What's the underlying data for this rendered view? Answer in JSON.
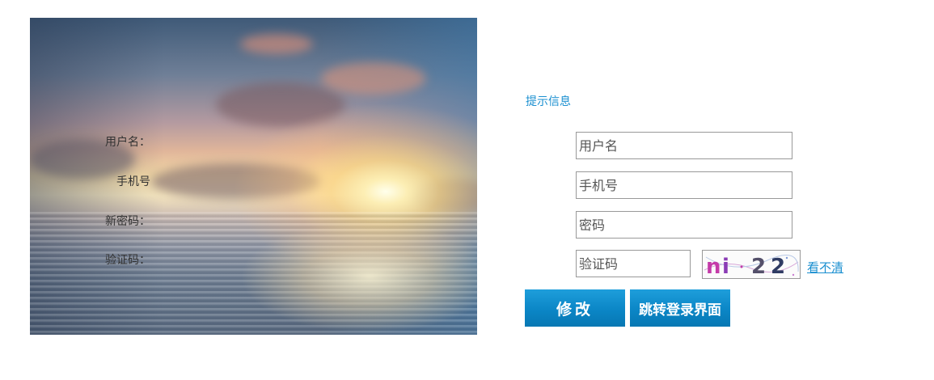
{
  "form": {
    "hint": "提示信息",
    "username": {
      "label": "用户名：",
      "placeholder": "用户名",
      "value": ""
    },
    "phone": {
      "label": "手机号",
      "placeholder": "手机号",
      "value": ""
    },
    "new_password": {
      "label": "新密码：",
      "placeholder": "密码",
      "value": ""
    },
    "captcha": {
      "label": "验证码：",
      "placeholder": "验证码",
      "value": "",
      "image_text": "ni22",
      "refresh_link": "看不清"
    },
    "buttons": {
      "modify": "修改",
      "go_login": "跳转登录界面"
    }
  },
  "colors": {
    "accent": "#1a8fd0",
    "button": "#0b86c6"
  }
}
